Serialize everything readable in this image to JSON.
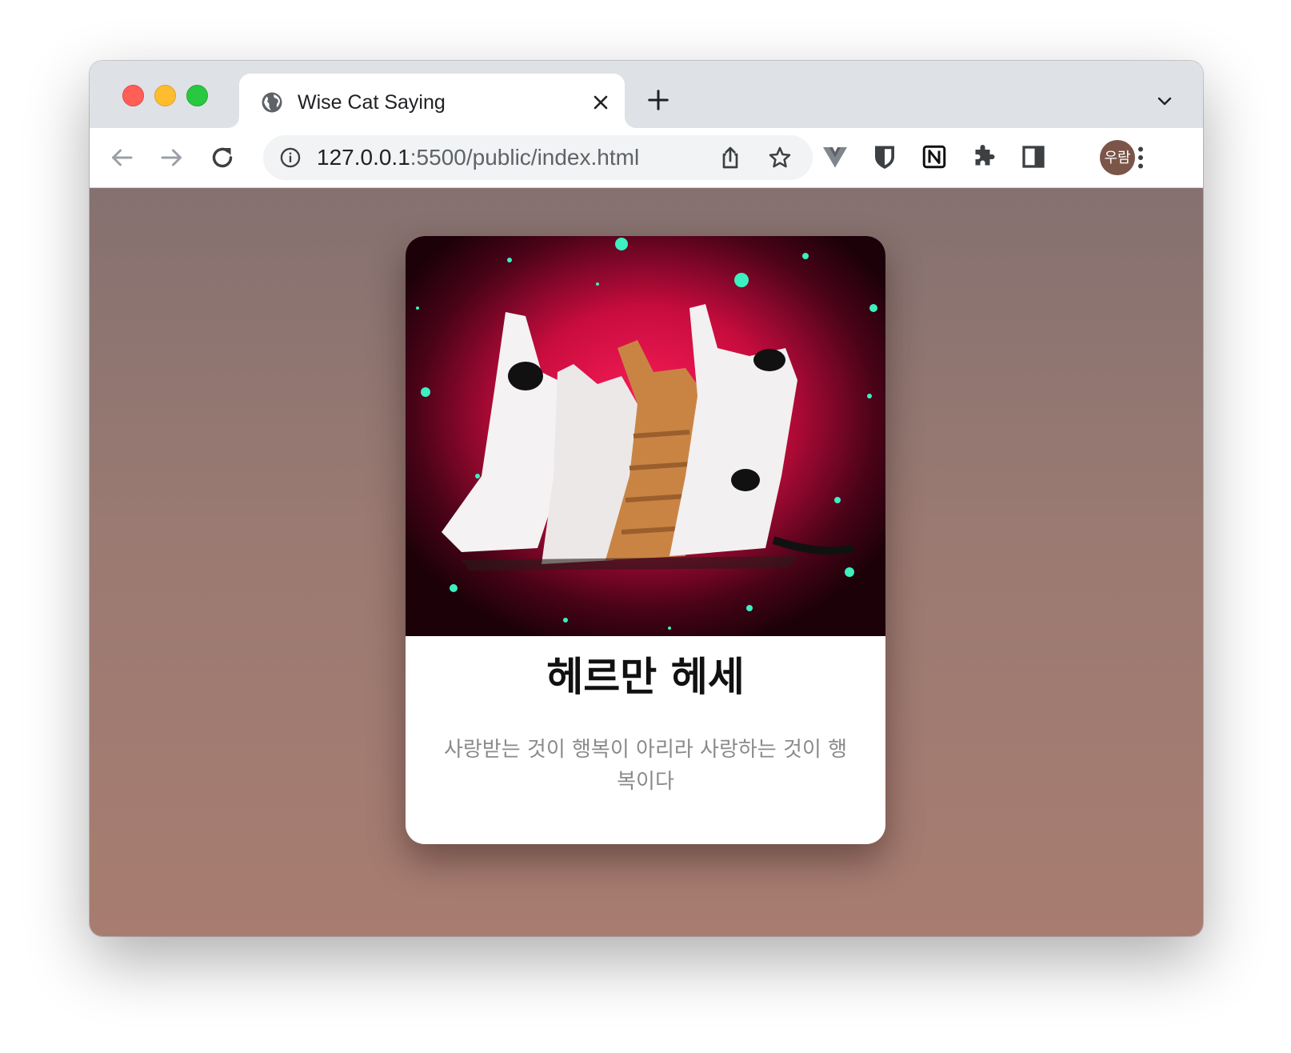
{
  "browser": {
    "tab_title": "Wise Cat Saying",
    "url_host": "127.0.0.1",
    "url_path": ":5500/public/index.html",
    "profile_initials": "우람"
  },
  "icons": {
    "favicon": "globe-icon",
    "tab_close": "close-icon",
    "new_tab": "plus-icon",
    "tab_search": "chevron-down-icon",
    "back": "arrow-left-icon",
    "forward": "arrow-right-icon",
    "reload": "reload-icon",
    "site_info": "info-icon",
    "share": "share-icon",
    "bookmark": "star-icon",
    "extensions": [
      "vue-devtools-icon",
      "bitwarden-icon",
      "notion-icon",
      "puzzle-icon",
      "side-panel-icon"
    ],
    "menu": "kebab-menu-icon"
  },
  "colors": {
    "background_top": "#857170",
    "background_bottom": "#a87c70",
    "card_bg": "#ffffff",
    "title_color": "#111111",
    "quote_color": "#8a8a8a"
  },
  "card": {
    "image_alt": "cats in space",
    "author": "헤르만 헤세",
    "quote": "사랑받는 것이 행복이 아리라 사랑하는 것이 행복이다"
  }
}
